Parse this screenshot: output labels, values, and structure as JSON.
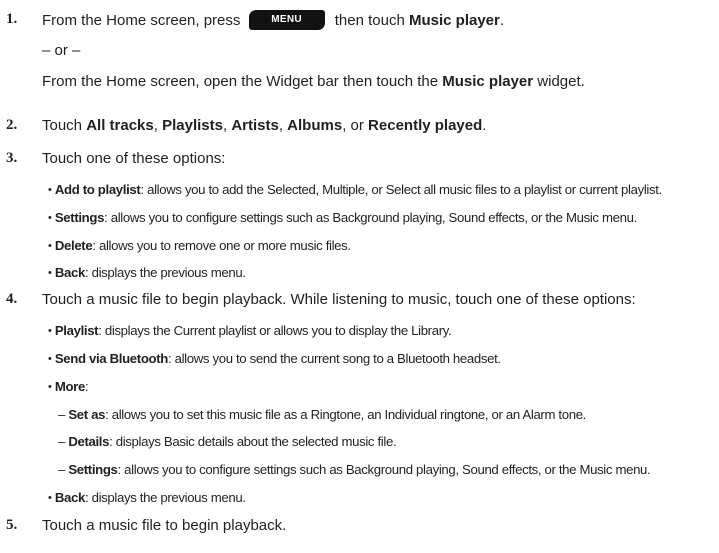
{
  "step1": {
    "num": "1.",
    "pre": "From the Home screen, press",
    "key": "MENU",
    "mid": "then touch",
    "bold": "Music player",
    "end": ".",
    "or": "– or –",
    "alt_pre": "From the Home screen, open the Widget bar then touch the",
    "alt_bold": "Music player",
    "alt_post": "widget."
  },
  "step2": {
    "num": "2.",
    "pre": "Touch",
    "b1": "All tracks",
    "s1": ",",
    "b2": "Playlists",
    "s2": ",",
    "b3": "Artists",
    "s3": ",",
    "b4": "Albums",
    "s4": ", or",
    "b5": "Recently played",
    "end": "."
  },
  "step3": {
    "num": "3.",
    "text": "Touch one of these options:",
    "items": [
      {
        "bold": "Add to playlist",
        "text": ": allows you to add the Selected, Multiple, or Select all music files to a playlist or current playlist."
      },
      {
        "bold": "Settings",
        "text": ": allows you to configure settings such as Background playing, Sound effects, or the Music menu."
      },
      {
        "bold": "Delete",
        "text": ": allows you to remove one or more music files."
      },
      {
        "bold": "Back",
        "text": ": displays the previous menu."
      }
    ]
  },
  "step4": {
    "num": "4.",
    "text": "Touch a music file to begin playback. While listening to music, touch one of these options:",
    "items": [
      {
        "bold": "Playlist",
        "text": ": displays the Current playlist or allows you to display the Library."
      },
      {
        "bold": "Send via Bluetooth",
        "text": ": allows you to send the current song to a Bluetooth headset."
      },
      {
        "bold": "More",
        "text": ":"
      }
    ],
    "subitems": [
      {
        "dash": "–",
        "bold": "Set as",
        "text": ": allows you to set this music file as a Ringtone, an Individual ringtone, or an Alarm tone."
      },
      {
        "dash": "–",
        "bold": "Details",
        "text": ": displays Basic details about the selected music file."
      },
      {
        "dash": "–",
        "bold": "Settings",
        "text": ": allows you to configure settings such as Background playing, Sound effects, or the Music menu."
      }
    ],
    "back": {
      "bold": "Back",
      "text": ": displays the previous menu."
    }
  },
  "step5": {
    "num": "5.",
    "text": "Touch a music file to begin playback."
  },
  "bullet_glyph": "•"
}
